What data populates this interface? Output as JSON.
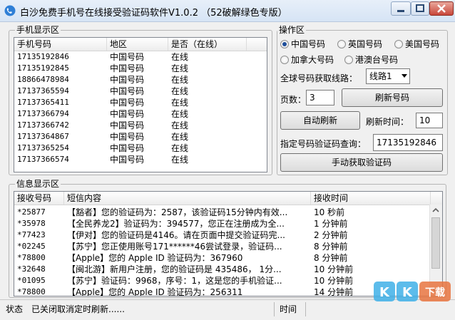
{
  "window": {
    "title": "白沙免费手机号在线接受验证码软件V1.0.2 （52破解绿色专版）"
  },
  "phone_group": {
    "title": "手机显示区",
    "columns": [
      "手机号码",
      "地区",
      "是否（在线）"
    ],
    "rows": [
      [
        "17135192846",
        "中国号码",
        "在线"
      ],
      [
        "17135192845",
        "中国号码",
        "在线"
      ],
      [
        "18866478984",
        "中国号码",
        "在线"
      ],
      [
        "17137365594",
        "中国号码",
        "在线"
      ],
      [
        "17137365411",
        "中国号码",
        "在线"
      ],
      [
        "17137366794",
        "中国号码",
        "在线"
      ],
      [
        "17137366742",
        "中国号码",
        "在线"
      ],
      [
        "17137364867",
        "中国号码",
        "在线"
      ],
      [
        "17137365254",
        "中国号码",
        "在线"
      ],
      [
        "17137366574",
        "中国号码",
        "在线"
      ]
    ]
  },
  "ops_group": {
    "title": "操作区",
    "radios": [
      {
        "label": "中国号码",
        "checked": true
      },
      {
        "label": "英国号码",
        "checked": false
      },
      {
        "label": "美国号码",
        "checked": false
      },
      {
        "label": "加拿大号码",
        "checked": false
      },
      {
        "label": "港澳台号码",
        "checked": false
      }
    ],
    "route_label": "全球号码获取线路：",
    "route_value": "线路1",
    "page_label": "页数：",
    "page_value": "3",
    "refresh_numbers_label": "刷新号码",
    "auto_refresh_label": "自动刷新",
    "refresh_time_label": "刷新时间：",
    "refresh_time_value": "10",
    "query_label": "指定号码验证码查询：",
    "query_value": "17135192846",
    "manual_fetch_label": "手动获取验证码"
  },
  "info_group": {
    "title": "信息显示区",
    "columns": [
      "接收号码",
      "短信内容",
      "接收时间"
    ],
    "rows": [
      [
        "*25877",
        "【豁者】您的验证码为：2587，该验证码15分钟内有效...",
        "10 秒前"
      ],
      [
        "*35978",
        "【全民养龙2】验证码为：394577，您正在注册成为全...",
        "1 分钟前"
      ],
      [
        "*77423",
        "【伊对】您的验证码是4146。请在页面中提交验证码完...",
        "2 分钟前"
      ],
      [
        "*02245",
        "【苏宁】您正使用账号171******46尝试登录，验证码...",
        "8 分钟前"
      ],
      [
        "*78800",
        "【Apple】您的 Apple ID 验证码为：367960",
        "8 分钟前"
      ],
      [
        "*32648",
        "【闽北游】新用户注册，您的验证码是 435486， 1分...",
        "10 分钟前"
      ],
      [
        "*01095",
        "【苏宁】验证码：9968，序号：1，这是您的手机验证...",
        "10 分钟前"
      ],
      [
        "*78800",
        "【Apple】您的 Apple ID 验证码为：256311",
        "14 分钟前"
      ]
    ]
  },
  "status": {
    "label": "状态",
    "message": "已关闭取消定时刷新......",
    "time_label": "时间"
  },
  "watermark": {
    "text": "KK下载"
  }
}
